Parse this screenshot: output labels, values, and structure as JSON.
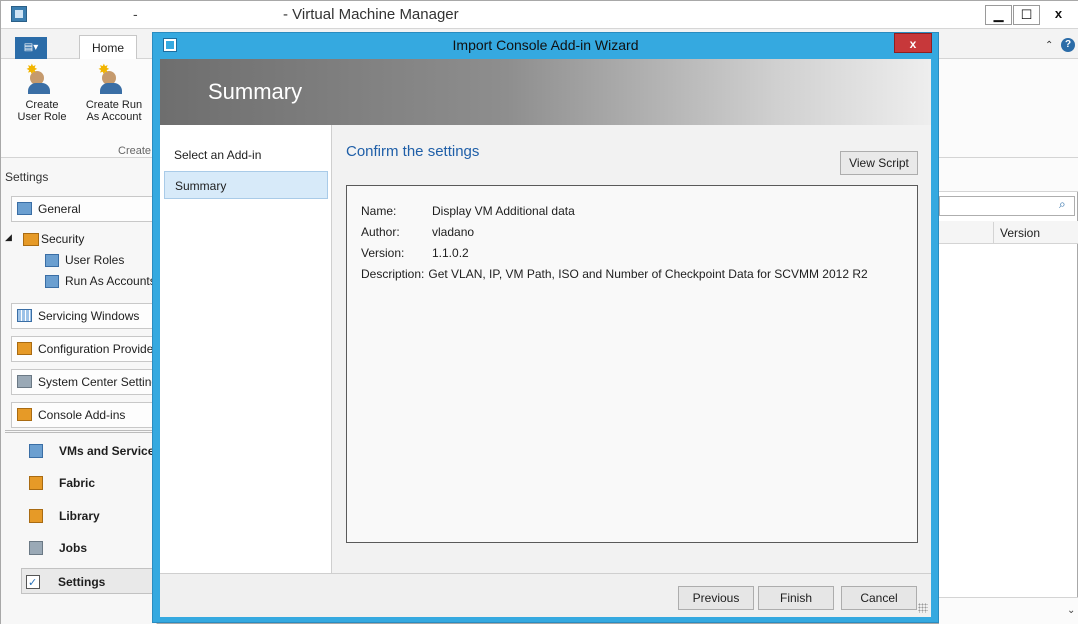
{
  "main_window": {
    "title": "- Virtual Machine Manager",
    "title_dash": "-",
    "minimize_glyph": "▁",
    "maximize_glyph": "☐",
    "close_glyph": "x"
  },
  "ribbon": {
    "file_menu_glyph": "▤▾",
    "home_tab": "Home",
    "collapse_glyph": "⌃",
    "help_glyph": "?",
    "create_user_role": "Create\nUser Role",
    "create_user_role_l1": "Create",
    "create_user_role_l2": "User Role",
    "create_runas_l1": "Create Run",
    "create_runas_l2": "As Account",
    "group_label": "Create"
  },
  "left_nav": {
    "heading": "Settings",
    "items": {
      "general": "General",
      "security": "Security",
      "user_roles": "User Roles",
      "run_as_accounts": "Run As Accounts",
      "servicing_windows": "Servicing Windows",
      "configuration_providers": "Configuration Providers",
      "system_center_settings": "System Center Settings",
      "console_addins": "Console Add-ins"
    },
    "workspaces": {
      "vms_services": "VMs and Services",
      "fabric": "Fabric",
      "library": "Library",
      "jobs": "Jobs",
      "settings": "Settings"
    }
  },
  "grid": {
    "version_column": "Version"
  },
  "wizard": {
    "title": "Import Console Add-in Wizard",
    "close_glyph": "x",
    "banner_title": "Summary",
    "steps": {
      "select": "Select an Add-in",
      "summary": "Summary"
    },
    "heading": "Confirm the settings",
    "view_script": "View Script",
    "summary": {
      "name_label": "Name:",
      "name_value": "Display VM Additional data",
      "author_label": "Author:",
      "author_value": "vladano",
      "version_label": "Version:",
      "version_value": "1.1.0.2",
      "description_label": "Description:",
      "description_value": "Get VLAN, IP, VM Path, ISO and Number of Checkpoint Data for SCVMM 2012 R2"
    },
    "buttons": {
      "previous": "Previous",
      "finish": "Finish",
      "cancel": "Cancel"
    }
  }
}
